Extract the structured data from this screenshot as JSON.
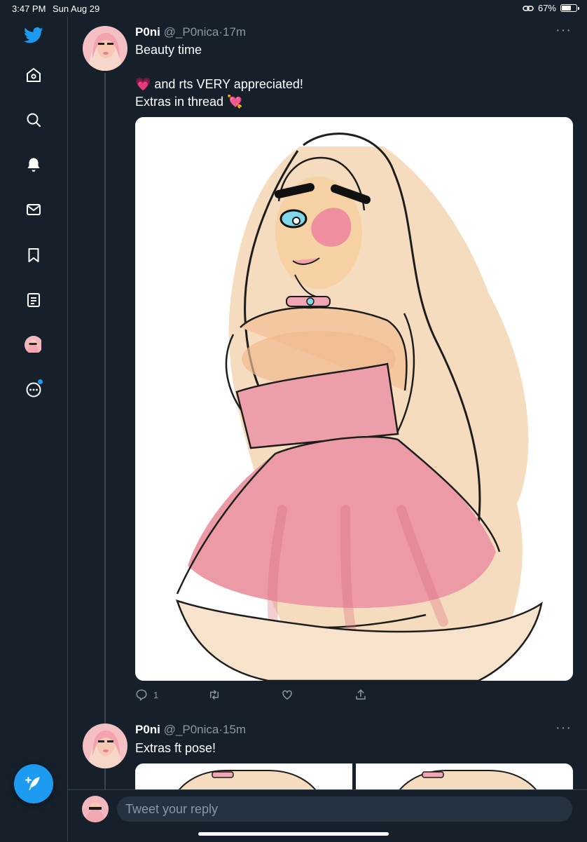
{
  "status_bar": {
    "time": "3:47 PM",
    "date": "Sun Aug 29",
    "battery": "67%",
    "battery_level": 0.67
  },
  "sidebar": {
    "items": [
      {
        "icon": "twitter-logo-icon"
      },
      {
        "icon": "home-icon"
      },
      {
        "icon": "search-icon"
      },
      {
        "icon": "notifications-bell-icon"
      },
      {
        "icon": "messages-envelope-icon"
      },
      {
        "icon": "bookmark-icon"
      },
      {
        "icon": "lists-icon"
      },
      {
        "icon": "profile-avatar-icon"
      },
      {
        "icon": "more-options-icon"
      }
    ],
    "compose_icon": "compose-feather-icon"
  },
  "tweets": [
    {
      "name": "P0ni",
      "handle": "@_P0nica",
      "time": "17m",
      "line1": "Beauty time",
      "line2": "💗 and rts VERY appreciated!",
      "line3": "Extras in thread 💘",
      "reply_count": "1",
      "retweet_count": "",
      "like_count": ""
    },
    {
      "name": "P0ni",
      "handle": "@_P0nica",
      "time": "15m",
      "line1": "Extras ft pose!"
    }
  ],
  "reply_bar": {
    "placeholder": "Tweet your reply"
  },
  "colors": {
    "background": "#15202b",
    "accent": "#1d9bf0",
    "muted": "#8899a6",
    "divider": "#38444d"
  }
}
